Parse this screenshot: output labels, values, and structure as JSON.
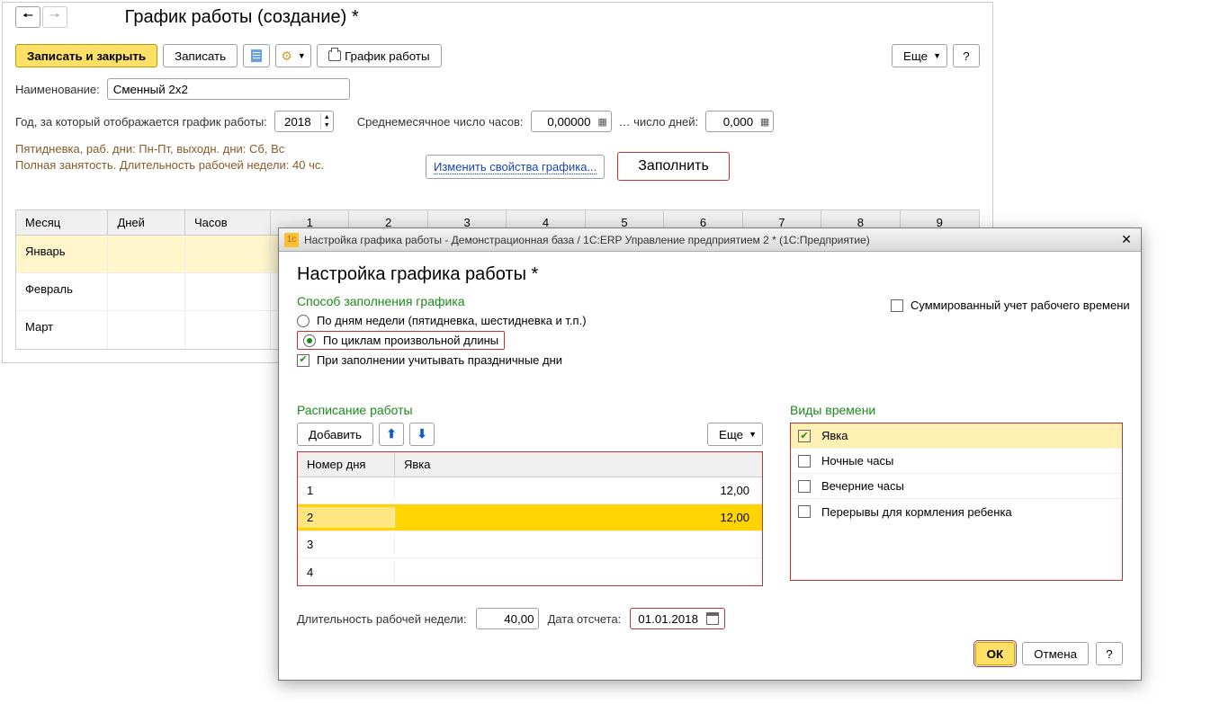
{
  "main": {
    "title": "График работы (создание) *",
    "toolbar": {
      "write_close": "Записать и закрыть",
      "write": "Записать",
      "print_schedule": "График работы",
      "more": "Еще"
    },
    "fields": {
      "name_label": "Наименование:",
      "name_value": "Сменный 2х2",
      "year_label": "Год, за который отображается график работы:",
      "year_value": "2018",
      "avg_hours_label": "Среднемесячное число часов:",
      "avg_hours_value": "0,00000",
      "avg_days_label": "… число дней:",
      "avg_days_value": "0,000"
    },
    "summary_line1": "Пятидневка, раб. дни: Пн-Пт, выходн. дни: Сб, Вс",
    "summary_line2": "Полная занятость. Длительность рабочей недели: 40 чс.",
    "change_link": "Изменить свойства графика...",
    "fill_button": "Заполнить",
    "grid": {
      "headers": {
        "month": "Месяц",
        "days": "Дней",
        "hours": "Часов"
      },
      "day_cols": [
        "1",
        "2",
        "3",
        "4",
        "5",
        "6",
        "7",
        "8",
        "9"
      ],
      "rows": [
        {
          "month": "Январь"
        },
        {
          "month": "Февраль"
        },
        {
          "month": "Март"
        }
      ]
    }
  },
  "dialog": {
    "window_title": "Настройка графика работы - Демонстрационная база / 1С:ERP Управление предприятием 2 *  (1С:Предприятие)",
    "title": "Настройка графика работы *",
    "fill_method_title": "Способ заполнения графика",
    "radio_weekdays": "По дням недели (пятидневка, шестидневка и т.п.)",
    "radio_cycles": "По циклам произвольной длины",
    "check_holidays": "При заполнении учитывать праздничные дни",
    "summed_check": "Суммированный учет рабочего времени",
    "schedule_title": "Расписание работы",
    "add_button": "Добавить",
    "more": "Еще",
    "sched_headers": {
      "num": "Номер дня",
      "att": "Явка"
    },
    "sched_rows": [
      {
        "num": "1",
        "val": "12,00"
      },
      {
        "num": "2",
        "val": "12,00"
      },
      {
        "num": "3",
        "val": ""
      },
      {
        "num": "4",
        "val": ""
      }
    ],
    "time_types_title": "Виды времени",
    "time_types": [
      {
        "label": "Явка",
        "checked": true,
        "selected": true
      },
      {
        "label": "Ночные часы",
        "checked": false
      },
      {
        "label": "Вечерние часы",
        "checked": false
      },
      {
        "label": "Перерывы для кормления ребенка",
        "checked": false
      }
    ],
    "week_len_label": "Длительность рабочей недели:",
    "week_len_value": "40,00",
    "start_date_label": "Дата отсчета:",
    "start_date_value": "01.01.2018",
    "ok": "ОК",
    "cancel": "Отмена"
  }
}
